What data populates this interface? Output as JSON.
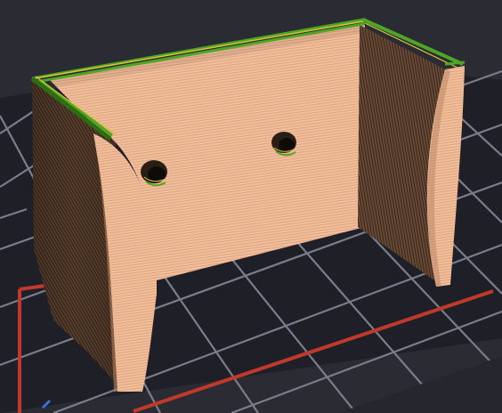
{
  "viewport": {
    "name": "3d-print-preview",
    "background_color": "#2b2c33",
    "grid_line_color": "#7a7d8c",
    "bed_cell_color": "#1e1f27",
    "bed_outline_color": "#c0392b",
    "layer_color_light": "#f3c09d",
    "layer_color_dark": "#3a2b22",
    "perimeter_green": "#4fa524",
    "perimeter_yellow": "#d8c43a"
  },
  "model": {
    "type": "sliced-part",
    "features": [
      "back-wall",
      "left-side-wall",
      "right-side-wall",
      "mounting-hole-left",
      "mounting-hole-right"
    ]
  }
}
